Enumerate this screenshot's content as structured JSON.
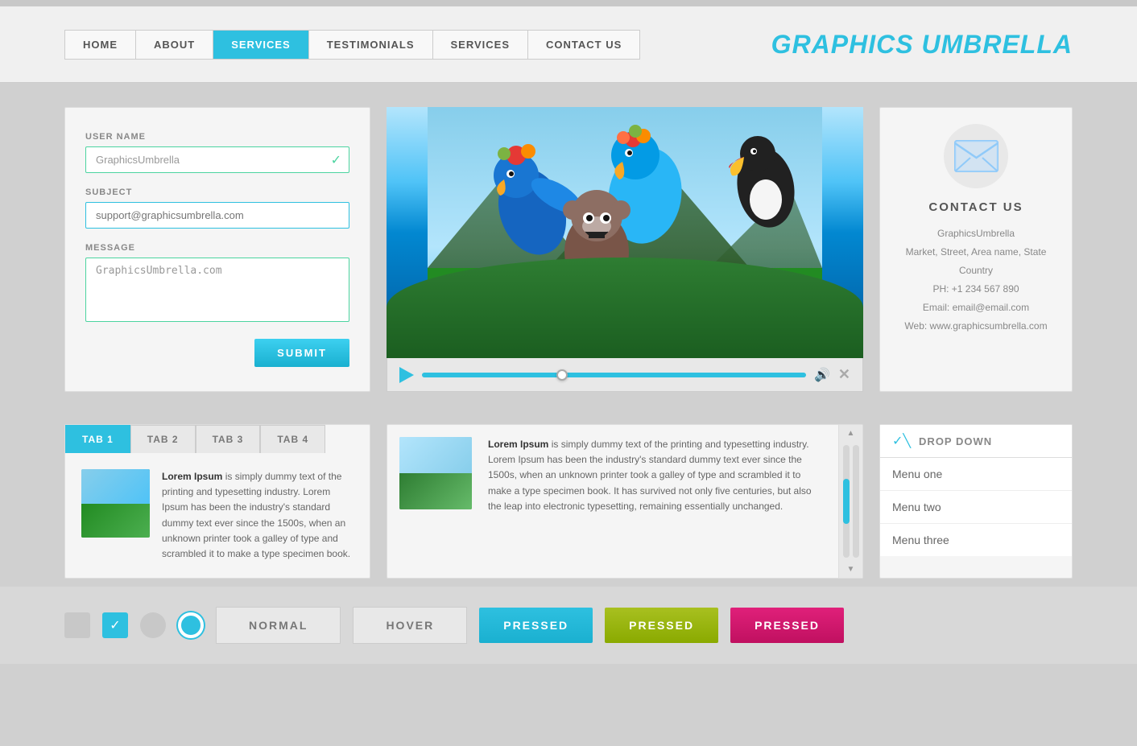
{
  "brand": "GRAPHICS UMBRELLA",
  "nav": {
    "items": [
      {
        "label": "HOME",
        "active": false
      },
      {
        "label": "ABOUT",
        "active": false
      },
      {
        "label": "SERVICES",
        "active": true
      },
      {
        "label": "TESTIMONIALS",
        "active": false
      },
      {
        "label": "SERVICES",
        "active": false
      },
      {
        "label": "CONTACT US",
        "active": false
      }
    ]
  },
  "form": {
    "username_label": "USER NAME",
    "username_value": "GraphicsUmbrella",
    "subject_label": "SUBJECT",
    "subject_placeholder": "support@graphicsumbrella.com",
    "message_label": "MESSAGE",
    "message_value": "GraphicsUmbrella.com",
    "submit_label": "SUBMIT"
  },
  "contact": {
    "title": "CONTACT US",
    "company": "GraphicsUmbrella",
    "address": "Market, Street, Area name, State",
    "country": "Country",
    "phone": "PH: +1 234 567 890",
    "email": "Email: email@email.com",
    "web": "Web: www.graphicsumbrella.com"
  },
  "tabs": {
    "items": [
      "TAB 1",
      "TAB 2",
      "TAB 3",
      "TAB 4"
    ],
    "active": 0,
    "content": "Lorem Ipsum is simply dummy text of the printing and typesetting industry. Lorem Ipsum has been the industry's standard dummy text ever since the 1500s, when an unknown printer took a galley of type and scrambled it to make a type specimen book."
  },
  "text_panel": {
    "content": "Lorem Ipsum is simply dummy text of the printing and typesetting industry. Lorem Ipsum has been the industry's standard dummy text ever since the 1500s, when an unknown printer took a galley of type and scrambled it to make a type specimen book. It has survived not only five centuries, but also the leap into electronic typesetting, remaining essentially unchanged."
  },
  "dropdown": {
    "label": "DROP DOWN",
    "items": [
      "Menu one",
      "Menu two",
      "Menu three"
    ]
  },
  "buttons": {
    "normal": "NORMAL",
    "hover": "HOVER",
    "pressed1": "PRESSED",
    "pressed2": "PRESSED",
    "pressed3": "PRESSED"
  }
}
